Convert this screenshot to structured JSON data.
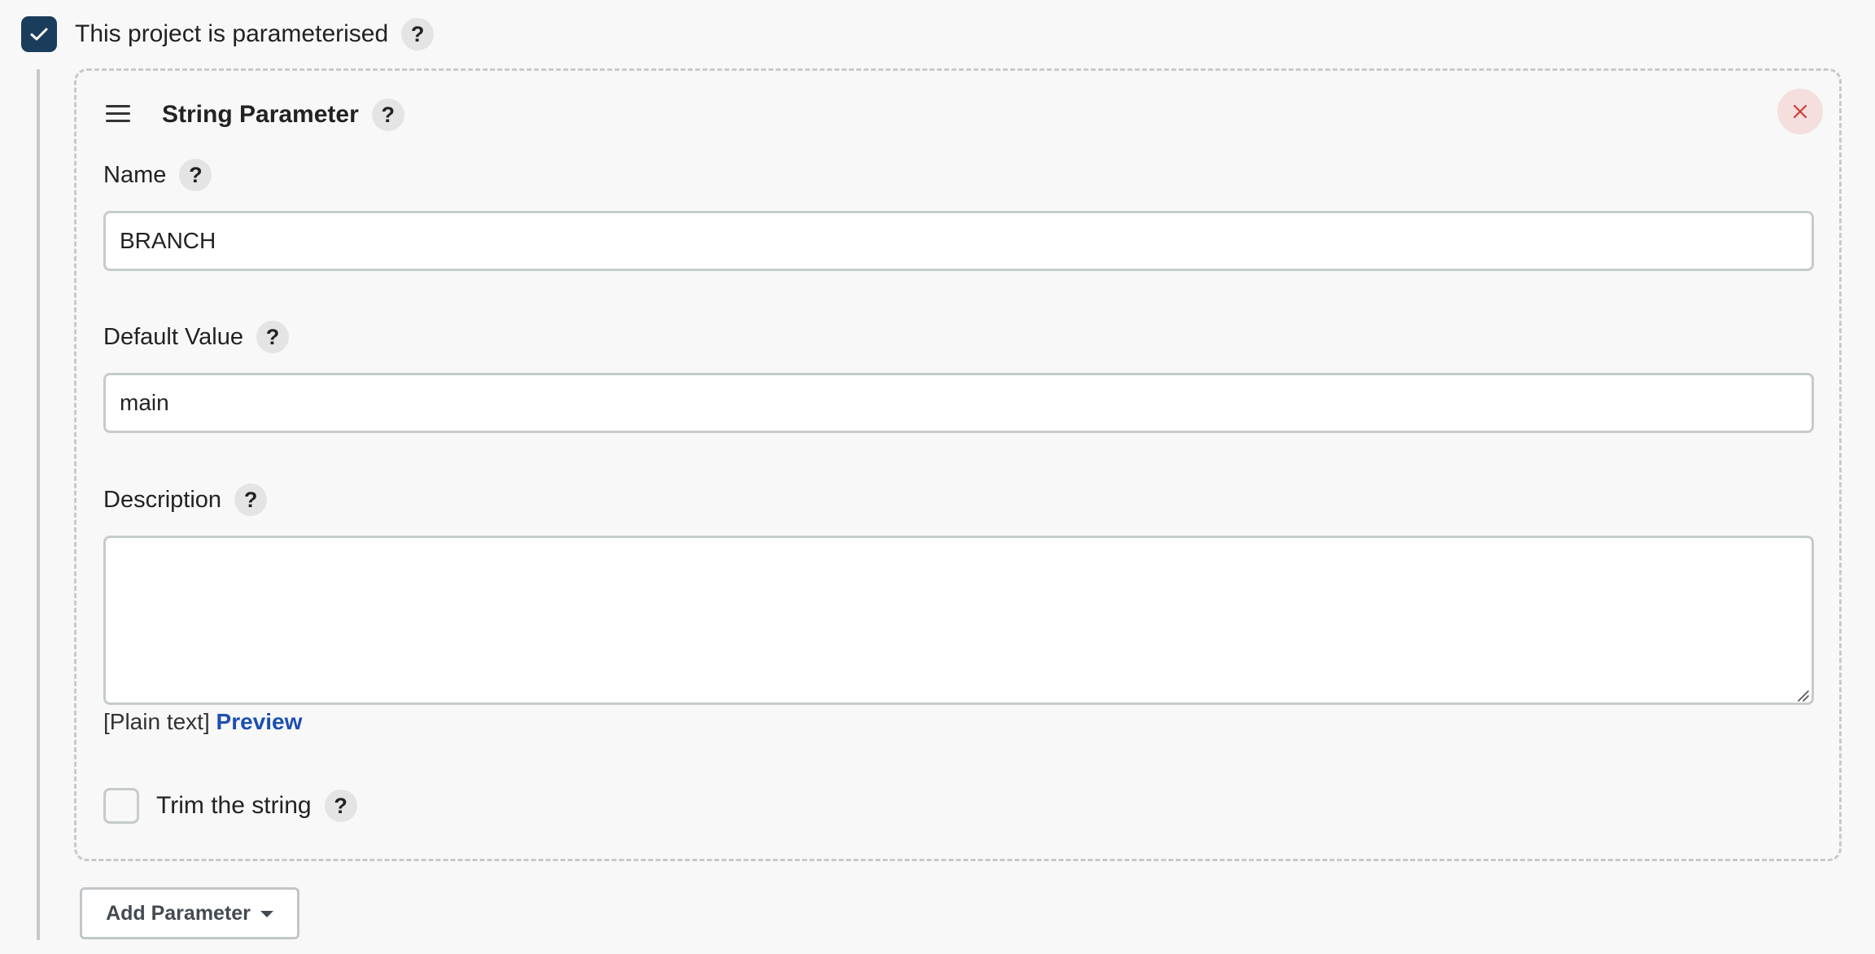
{
  "parameterised": {
    "label": "This project is parameterised",
    "checked": true,
    "help": "?"
  },
  "parameter": {
    "type_title": "String Parameter",
    "help": "?",
    "close_icon": "close-icon",
    "drag_icon": "drag-handle-icon",
    "name": {
      "label": "Name",
      "help": "?",
      "value": "BRANCH"
    },
    "default_value": {
      "label": "Default Value",
      "help": "?",
      "value": "main"
    },
    "description": {
      "label": "Description",
      "help": "?",
      "value": "",
      "format_note": "[Plain text]",
      "preview_link": "Preview"
    },
    "trim": {
      "label": "Trim the string",
      "help": "?",
      "checked": false
    }
  },
  "add_parameter": {
    "label": "Add Parameter"
  },
  "colors": {
    "checkbox_checked_bg": "#1b3d5c",
    "link": "#1c4fb0",
    "close_icon": "#d13b3b",
    "close_bg": "#f4dede"
  }
}
